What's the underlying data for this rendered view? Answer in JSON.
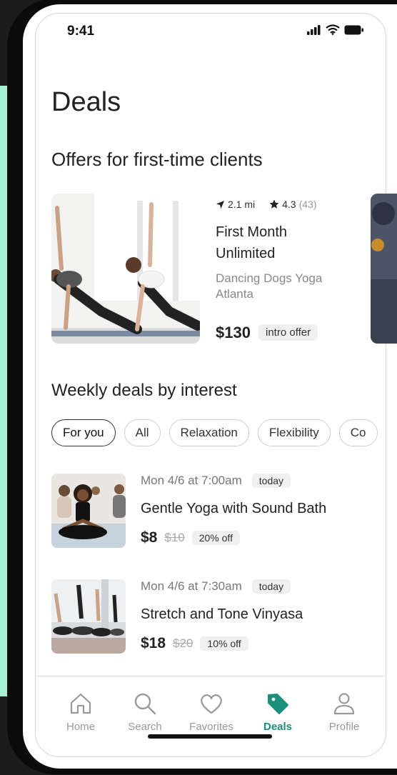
{
  "status_bar": {
    "time": "9:41"
  },
  "page": {
    "title": "Deals"
  },
  "offers": {
    "section_title": "Offers for first-time clients",
    "card": {
      "distance": "2.1 mi",
      "rating": "4.3",
      "reviews": "(43)",
      "name": "First Month Unlimited",
      "studio": "Dancing Dogs Yoga Atlanta",
      "price": "$130",
      "badge": "intro offer"
    }
  },
  "weekly": {
    "section_title": "Weekly deals by interest",
    "chips": [
      "For you",
      "All",
      "Relaxation",
      "Flexibility",
      "Co"
    ],
    "active_chip": "For you",
    "deals": [
      {
        "date": "Mon 4/6 at 7:00am",
        "tag": "today",
        "name": "Gentle Yoga with Sound Bath",
        "price": "$8",
        "original_price": "$10",
        "discount": "20% off"
      },
      {
        "date": "Mon 4/6 at 7:30am",
        "tag": "today",
        "name": "Stretch and Tone Vinyasa",
        "price": "$18",
        "original_price": "$20",
        "discount": "10% off"
      }
    ]
  },
  "tabbar": {
    "items": [
      {
        "label": "Home",
        "icon": "home-icon"
      },
      {
        "label": "Search",
        "icon": "search-icon"
      },
      {
        "label": "Favorites",
        "icon": "heart-icon"
      },
      {
        "label": "Deals",
        "icon": "tag-icon"
      },
      {
        "label": "Profile",
        "icon": "profile-icon"
      }
    ],
    "active": "Deals"
  },
  "colors": {
    "accent": "#1a8f7a",
    "side_strip": "#a6f0d4",
    "device_frame": "#0b0b0b"
  }
}
